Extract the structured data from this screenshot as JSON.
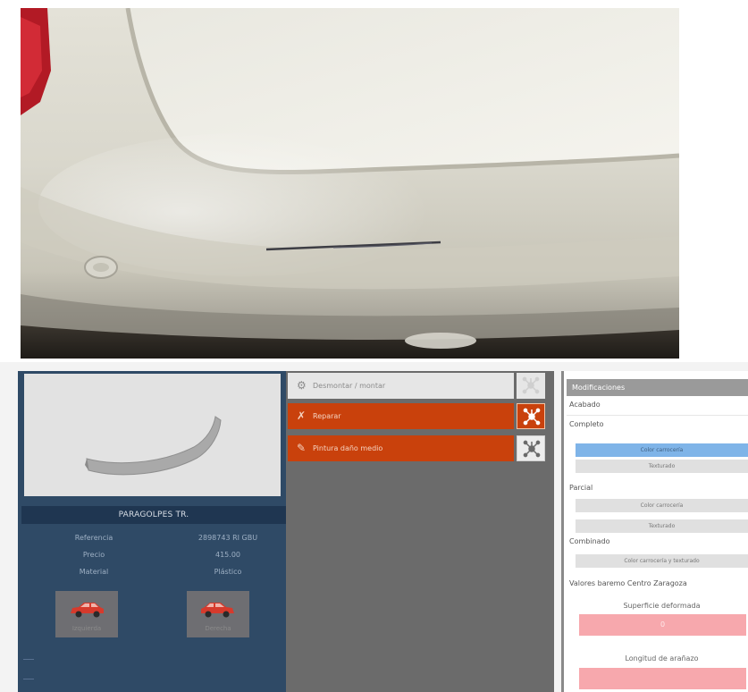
{
  "part": {
    "title": "PARAGOLPES TR.",
    "info": [
      {
        "key": "Referencia",
        "value": "2898743 RI GBU"
      },
      {
        "key": "Precio",
        "value": "415.00"
      },
      {
        "key": "Material",
        "value": "Plástico"
      }
    ],
    "side_buttons": [
      {
        "label": "Izquierda"
      },
      {
        "label": "Derecha"
      }
    ]
  },
  "operations": [
    {
      "label": "Desmontar / montar",
      "icon": "gears-icon",
      "state": "inactive"
    },
    {
      "label": "Reparar",
      "icon": "tools-icon",
      "state": "active"
    },
    {
      "label": "Pintura daño medio",
      "icon": "spray-gun-icon",
      "state": "active"
    }
  ],
  "modifications": {
    "header": "Modificaciones",
    "acabado_label": "Acabado",
    "completo_label": "Completo",
    "completo_options": [
      "Color carrocería",
      "Texturado"
    ],
    "completo_selected": "Color carrocería",
    "parcial_label": "Parcial",
    "parcial_options": [
      "Color carrocería",
      "Texturado"
    ],
    "combinado_label": "Combinado",
    "combinado_options": [
      "Color carrocería y texturado"
    ],
    "valores_label": "Valores baremo Centro Zaragoza",
    "superficie_label": "Superficie deformada",
    "superficie_value": "0",
    "longitud_label": "Longitud de arañazo",
    "longitud_value": ""
  },
  "colors": {
    "accent_orange": "#c9410c",
    "panel_blue": "#2f4a66",
    "selected_blue": "#7fb4e8",
    "field_pink": "#f7a8ad"
  }
}
